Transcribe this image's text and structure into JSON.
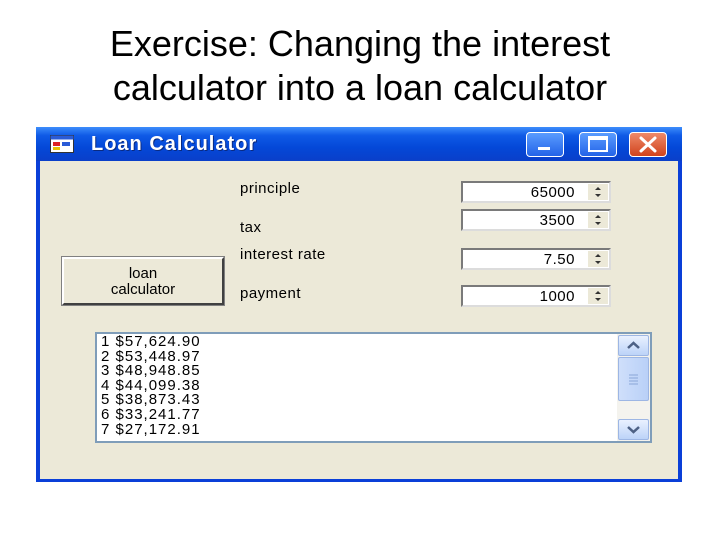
{
  "slide": {
    "title_line1": "Exercise: Changing the interest",
    "title_line2": "calculator into a loan calculator"
  },
  "window": {
    "title": "Loan Calculator",
    "icons": {
      "app": "app-window-icon",
      "minimize": "minimize-icon",
      "maximize": "maximize-icon",
      "close": "close-icon"
    }
  },
  "form": {
    "fields": [
      {
        "label": "principle",
        "value": "65000"
      },
      {
        "label": "tax",
        "value": "3500"
      },
      {
        "label": "interest rate",
        "value": "7.50"
      },
      {
        "label": "payment",
        "value": "1000"
      }
    ],
    "button_line1": "loan",
    "button_line2": "calculator"
  },
  "results": {
    "items": [
      "1  $57,624.90",
      "2  $53,448.97",
      "3  $48,948.85",
      "4  $44,099.38",
      "5  $38,873.43",
      "6  $33,241.77",
      "7  $27,172.91"
    ]
  },
  "colors": {
    "titlebar": "#0a3fd8",
    "client_background": "#ece9d8",
    "close_button": "#d1431c"
  }
}
